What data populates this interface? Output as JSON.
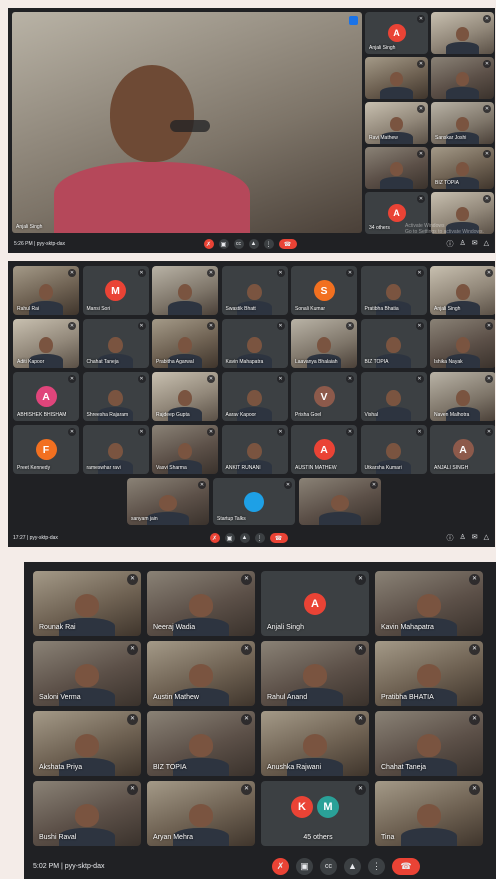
{
  "colors": {
    "red": "#ea4335",
    "orange": "#f27020",
    "teal": "#2aa198",
    "pink": "#e0457b",
    "brown": "#8d5a4b",
    "blue": "#1ea0e6"
  },
  "p1": {
    "time_meet": "5:26 PM | pyy-sktp-dax",
    "main_speaker": "Anjali Singh",
    "side": [
      {
        "name": "Anjali Singh",
        "avatar": "A",
        "color": "#ea4335"
      },
      {
        "name": ""
      },
      {
        "name": ""
      },
      {
        "name": ""
      },
      {
        "name": "Ravi Mathew"
      },
      {
        "name": "Sanskar Joshi"
      },
      {
        "name": ""
      },
      {
        "name": "BIZ TOPIA"
      },
      {
        "name": "34 others",
        "avatar": "A",
        "color": "#ea4335"
      },
      {
        "name": ""
      }
    ],
    "watermark_line1": "Activate Windows",
    "watermark_line2": "Go to Settings to activate Windows."
  },
  "p2": {
    "time_meet": "17:27 | pyy-sktp-dax",
    "tiles": [
      {
        "name": "Rahul Rai"
      },
      {
        "name": "Mansi Sori",
        "avatar": "M",
        "color": "#ea4335"
      },
      {
        "name": ""
      },
      {
        "name": "Swastik Bhatt"
      },
      {
        "name": "Sonali Kumar",
        "avatar": "S",
        "color": "#f27020"
      },
      {
        "name": "Pratibha Bhatia"
      },
      {
        "name": "Anjali Singh"
      },
      {
        "name": "Aditi Kapoor"
      },
      {
        "name": "Chahat Taneja"
      },
      {
        "name": "Prabitha Agarwal"
      },
      {
        "name": "Kavin Mahapatra"
      },
      {
        "name": "Laavanya Bhalaiah"
      },
      {
        "name": "BIZ TOPIA"
      },
      {
        "name": "Ishika Nayak"
      },
      {
        "name": "ABHISHEK BHISHAM",
        "avatar": "A",
        "color": "#e0457b"
      },
      {
        "name": "Shreesha Rajaram"
      },
      {
        "name": "Rajdeep Gupta"
      },
      {
        "name": "Aarav Kapoor"
      },
      {
        "name": "Prisha Goel",
        "avatar": "V",
        "color": "#8d5a4b"
      },
      {
        "name": "Vishal"
      },
      {
        "name": "Naven Malhotra"
      },
      {
        "name": "Preet Kennedy",
        "avatar": "F",
        "color": "#f27020"
      },
      {
        "name": "rameswhar ravi"
      },
      {
        "name": "Vasvi Sharma"
      },
      {
        "name": "ANKIT RUNANI"
      },
      {
        "name": "AUSTIN MATHEW",
        "avatar": "A",
        "color": "#ea4335"
      },
      {
        "name": "Utkarsha Kumari"
      },
      {
        "name": "ANJALI SINGH",
        "avatar": "A",
        "color": "#8d5a4b"
      },
      {
        "name": "sanyam jain"
      },
      {
        "name": "Startup Talks",
        "avatar": "",
        "color": "#1ea0e6"
      },
      {
        "name": ""
      }
    ]
  },
  "p3": {
    "time_meet": "5:02 PM | pyy-sktp-dax",
    "tiles": [
      {
        "name": "Rounak Rai"
      },
      {
        "name": "Neeraj Wadia"
      },
      {
        "name": "Anjali Singh",
        "avatar": "A",
        "color": "#ea4335"
      },
      {
        "name": "Kavin Mahapatra"
      },
      {
        "name": "Saloni Verma"
      },
      {
        "name": "Austin Mathew"
      },
      {
        "name": "Rahul Anand"
      },
      {
        "name": "Pratibha BHATIA"
      },
      {
        "name": "Akshata Priya"
      },
      {
        "name": "BIZ TOPIA"
      },
      {
        "name": "Anushka Rajwani"
      },
      {
        "name": "Chahat Taneja"
      },
      {
        "name": "Bushi Raval"
      },
      {
        "name": "Aryan Mehra"
      },
      {
        "name": "45 others",
        "avatar": "K",
        "avatar2": "M",
        "color": "#ea4335",
        "color2": "#2aa198"
      },
      {
        "name": "Tina"
      }
    ]
  },
  "icons": [
    "mic-off-icon",
    "camera-icon",
    "cc-icon",
    "present-icon",
    "more-icon",
    "end-call-icon",
    "info-icon",
    "people-icon",
    "chat-icon",
    "activities-icon"
  ]
}
